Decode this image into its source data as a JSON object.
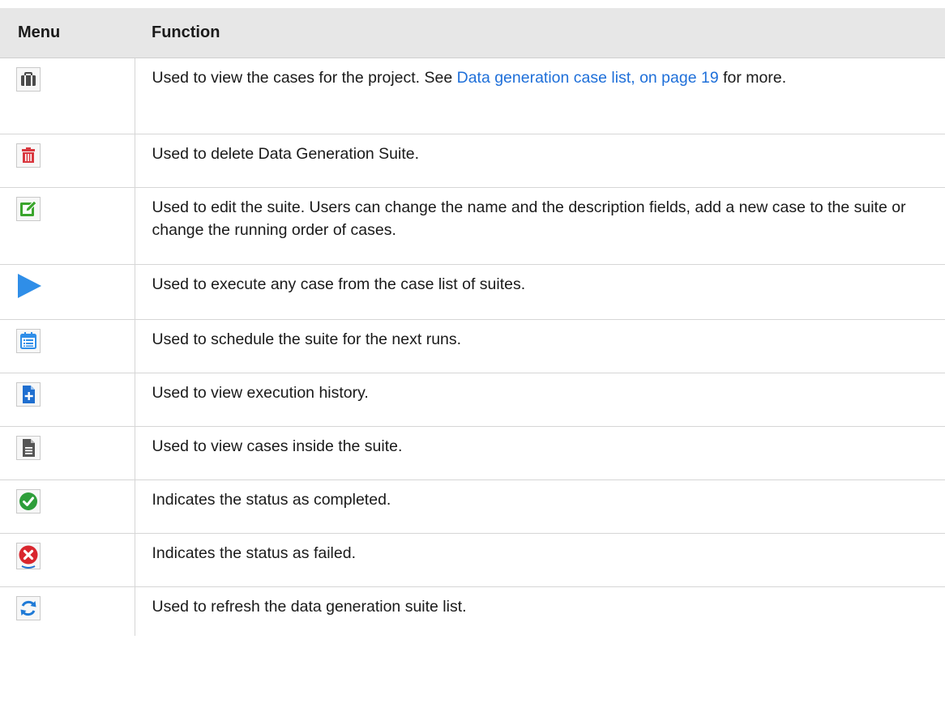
{
  "table": {
    "headers": {
      "menu": "Menu",
      "function": "Function"
    },
    "rows": [
      {
        "icon": "briefcase-icon",
        "text_before_link": "Used to view the cases for the project. See ",
        "link_text": "Data generation case list, on page 19",
        "text_after_link": " for more."
      },
      {
        "icon": "trash-icon",
        "text": "Used to delete Data Generation Suite."
      },
      {
        "icon": "edit-icon",
        "text": "Used to edit the suite. Users can change the name and the description fields, add a new case to the suite or change the running order of cases."
      },
      {
        "icon": "play-icon",
        "text": "Used to execute any case from the case list of suites."
      },
      {
        "icon": "calendar-icon",
        "text": "Used to schedule the suite for the next runs."
      },
      {
        "icon": "add-document-icon",
        "text": "Used to view execution history."
      },
      {
        "icon": "document-icon",
        "text": "Used to view cases inside the suite."
      },
      {
        "icon": "check-circle-icon",
        "text": "Indicates the status as completed."
      },
      {
        "icon": "error-circle-icon",
        "text": "Indicates the status as failed."
      },
      {
        "icon": "refresh-icon",
        "text": "Used to refresh the data generation suite list."
      }
    ]
  },
  "colors": {
    "header_bg": "#e7e7e7",
    "link": "#1e6fd9",
    "trash_red": "#d9363e",
    "edit_green": "#3aa52c",
    "play_blue": "#2f8ee8",
    "check_green": "#2e9e3a",
    "error_red": "#d9262e",
    "refresh_blue": "#1f7ad6"
  }
}
